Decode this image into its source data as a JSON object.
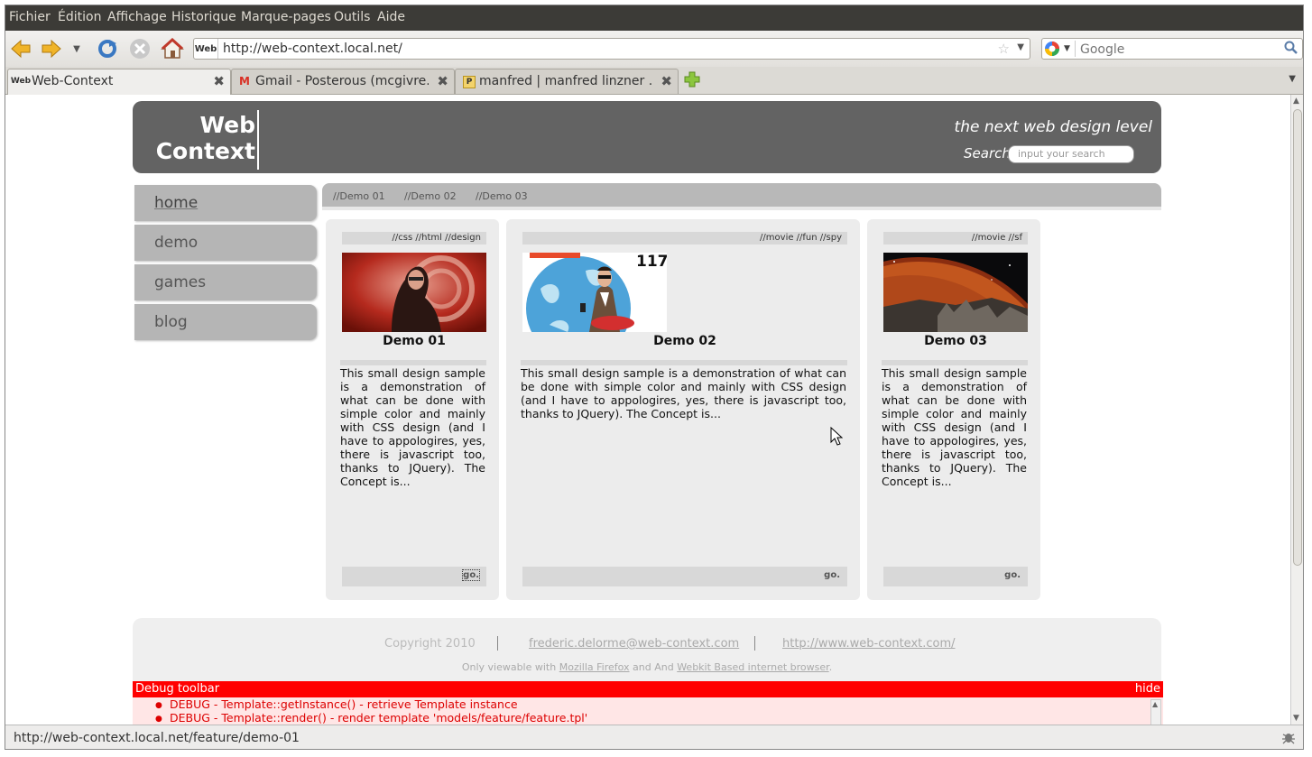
{
  "menu": [
    "Fichier",
    "Édition",
    "Affichage",
    "Historique",
    "Marque-pages",
    "Outils",
    "Aide"
  ],
  "browser": {
    "url": "http://web-context.local.net/",
    "site_icon": "Web",
    "search_placeholder": "Google"
  },
  "tabs": [
    {
      "label": "Web-Context",
      "icon": "Web",
      "active": true
    },
    {
      "label": "Gmail - Posterous (mcgivre...",
      "icon": "M",
      "active": false
    },
    {
      "label": "manfred | manfred linzner ...",
      "icon": "P",
      "active": false
    }
  ],
  "page": {
    "logo_line1": "Web",
    "logo_line2": "Context",
    "tagline": "the next web design level",
    "search_label": "Search",
    "search_placeholder": "input your search",
    "nav": [
      "home",
      "demo",
      "games",
      "blog"
    ],
    "crumbs": [
      "//Demo 01",
      "//Demo 02",
      "//Demo 03"
    ],
    "cards": [
      {
        "tags": "//css //html //design",
        "title": "Demo 01",
        "desc": "This small design sample is a demonstration of what can be done with simple color and mainly with CSS design (and I have to appologires, yes, there is javascript too, thanks to JQuery). The Concept is...",
        "go": "go."
      },
      {
        "tags": "//movie //fun //spy",
        "title": "Demo 02",
        "desc": "This small design sample is a demonstration of what can be done with simple color and mainly with CSS design (and I have to appologires, yes, there is javascript too, thanks to JQuery). The Concept is...",
        "go": "go.",
        "badge": "117"
      },
      {
        "tags": "//movie //sf",
        "title": "Demo 03",
        "desc": "This small design sample is a demonstration of what can be done with simple color and mainly with CSS design (and I have to appologires, yes, there is javascript too, thanks to JQuery). The Concept is...",
        "go": "go."
      }
    ],
    "footer": {
      "copyright": "Copyright 2010",
      "email": "frederic.delorme@web-context.com",
      "site": "http://www.web-context.com/",
      "note_prefix": "Only viewable with ",
      "note_firefox": "Mozilla Firefox",
      "note_mid": " and And ",
      "note_webkit": "Webkit Based internet browser",
      "note_suffix": "."
    },
    "debug": {
      "title": "Debug toolbar",
      "hide": "hide",
      "lines": [
        "DEBUG - Template::getInstance() - retrieve Template instance",
        "DEBUG - Template::render() - render template 'models/feature/feature.tpl'"
      ]
    }
  },
  "status": "http://web-context.local.net/feature/demo-01",
  "colors": {
    "header": "#636363",
    "debug_red": "#ff0000",
    "menubar": "#3c3b37"
  }
}
